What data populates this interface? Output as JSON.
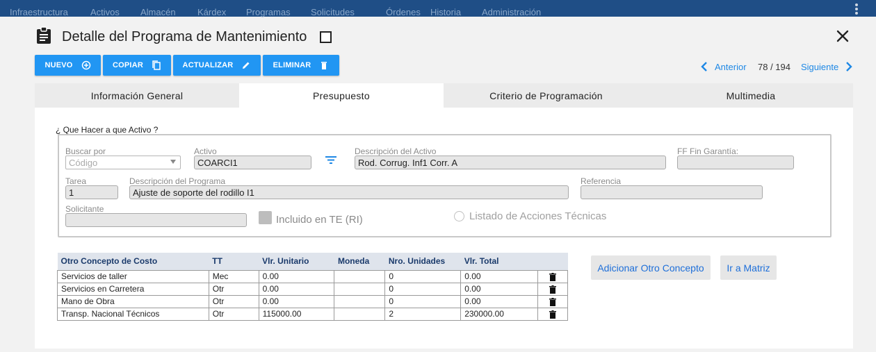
{
  "topnav": {
    "items": [
      "Infraestructura",
      "Activos",
      "Almacén",
      "Kárdex",
      "Programas",
      "Solicitudes",
      "Órdenes",
      "Historia",
      "Administración"
    ]
  },
  "header": {
    "title": "Detalle del Programa de Mantenimiento"
  },
  "toolbar": {
    "nuevo": "NUEVO",
    "copiar": "COPIAR",
    "actualizar": "ACTUALIZAR",
    "eliminar": "ELIMINAR"
  },
  "pager": {
    "previous": "Anterior",
    "count": "78 / 194",
    "next": "Siguiente"
  },
  "tabs": [
    "Información General",
    "Presupuesto",
    "Criterio de Programación",
    "Multimedia"
  ],
  "active_tab": "Presupuesto",
  "form": {
    "legend": "¿ Que Hacer a que Activo ?",
    "buscar_por_label": "Buscar por",
    "buscar_por_value": "Código",
    "activo_label": "Activo",
    "activo_value": "COARCI1",
    "desc_activo_label": "Descripción del Activo",
    "desc_activo_value": "Rod. Corrug. Inf1 Corr. A",
    "ff_fin_label": "FF Fin Garantía:",
    "ff_fin_value": "",
    "tarea_label": "Tarea",
    "tarea_value": "1",
    "desc_programa_label": "Descripción del Programa",
    "desc_programa_value": "Ajuste de soporte del rodillo I1",
    "referencia_label": "Referencia",
    "referencia_value": "",
    "solicitante_label": "Solicitante",
    "solicitante_value": "",
    "incluido_label": "Incluido en TE (RI)",
    "listado_label": "Listado de Acciones Técnicas"
  },
  "costs": {
    "headers": [
      "Otro Concepto de Costo",
      "TT",
      "Vlr. Unitario",
      "Moneda",
      "Nro. Unidades",
      "Vlr. Total"
    ],
    "rows": [
      [
        "Servicios de taller",
        "Mec",
        "0.00",
        "",
        "0",
        "0.00"
      ],
      [
        "Servicios en Carretera",
        "Otr",
        "0.00",
        "",
        "0",
        "0.00"
      ],
      [
        "Mano de Obra",
        "Otr",
        "0.00",
        "",
        "0",
        "0.00"
      ],
      [
        "Transp. Nacional Técnicos",
        "Otr",
        "115000.00",
        "",
        "2",
        "230000.00"
      ]
    ]
  },
  "actions": {
    "adicionar": "Adicionar Otro Concepto",
    "matriz": "Ir a Matriz"
  },
  "colors": {
    "nav_bg": "#1f4e86",
    "primary": "#2196f3",
    "link": "#1e88e5"
  },
  "icons": {
    "title": "clipboard-icon",
    "close": "close-icon",
    "filter": "filter-icon",
    "delete_row": "trash-icon"
  }
}
